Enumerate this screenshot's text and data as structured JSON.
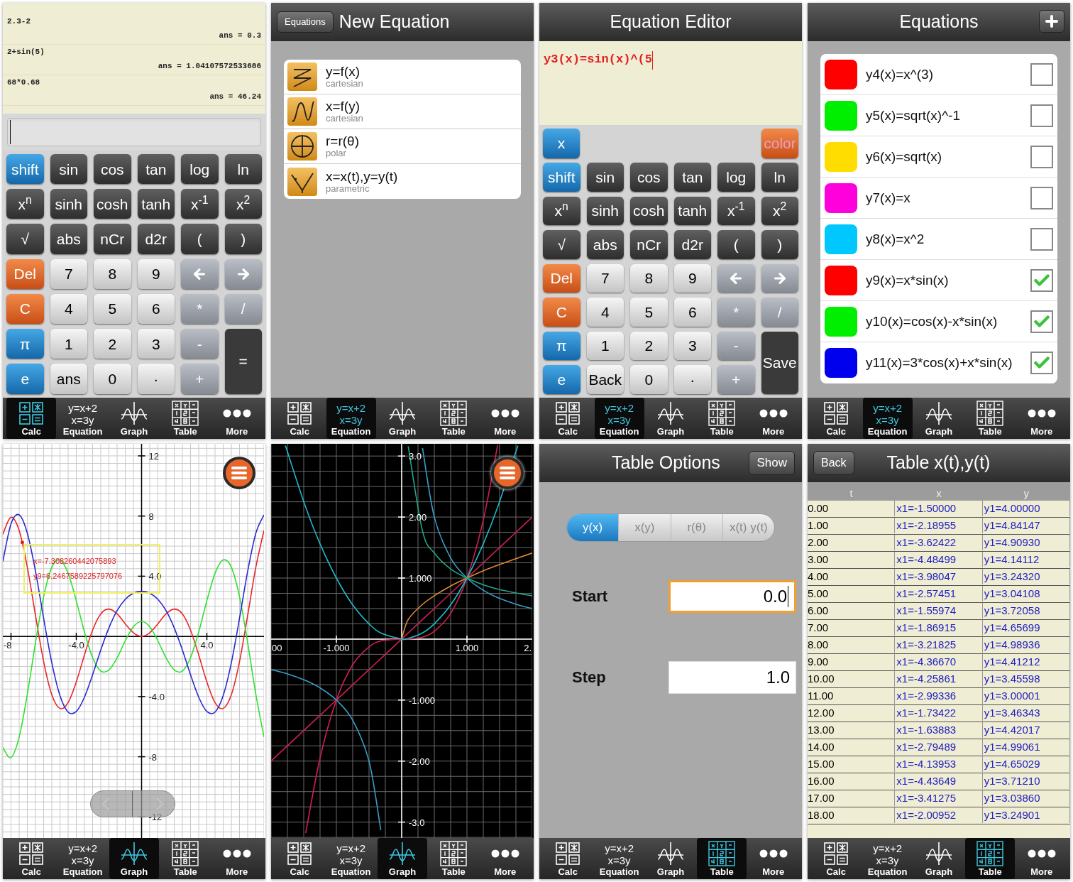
{
  "panels": [
    {
      "kind": "calculator",
      "history": [
        {
          "expr": "2.3-2",
          "result": "ans = 0.3"
        },
        {
          "expr": "2+sin(5)",
          "result": "ans = 1.04107572533686"
        },
        {
          "expr": "68*0.68",
          "result": "ans = 46.24"
        }
      ],
      "key_rows": [
        [
          {
            "label": "shift",
            "kind": "blue"
          },
          {
            "label": "sin",
            "kind": "fn"
          },
          {
            "label": "cos",
            "kind": "fn"
          },
          {
            "label": "tan",
            "kind": "fn"
          },
          {
            "label": "log",
            "kind": "fn"
          },
          {
            "label": "ln",
            "kind": "fn"
          }
        ],
        [
          {
            "label": "x$^{n}$",
            "kind": "fn"
          },
          {
            "label": "sinh",
            "kind": "fn"
          },
          {
            "label": "cosh",
            "kind": "fn"
          },
          {
            "label": "tanh",
            "kind": "fn"
          },
          {
            "label": "x$^{-1}$",
            "kind": "fn"
          },
          {
            "label": "x$^{2}$",
            "kind": "fn"
          }
        ],
        [
          {
            "label": "√",
            "kind": "fn"
          },
          {
            "label": "abs",
            "kind": "fn"
          },
          {
            "label": "nCr",
            "kind": "fn"
          },
          {
            "label": "d2r",
            "kind": "fn"
          },
          {
            "label": "(",
            "kind": "fn"
          },
          {
            "label": ")",
            "kind": "fn"
          }
        ],
        [
          {
            "label": "Del",
            "kind": "red"
          },
          {
            "label": "7",
            "kind": "num"
          },
          {
            "label": "8",
            "kind": "num"
          },
          {
            "label": "9",
            "kind": "num"
          },
          {
            "kind": "left"
          },
          {
            "kind": "right"
          }
        ],
        [
          {
            "label": "C",
            "kind": "red"
          },
          {
            "label": "4",
            "kind": "num"
          },
          {
            "label": "5",
            "kind": "num"
          },
          {
            "label": "6",
            "kind": "num"
          },
          {
            "label": "*",
            "kind": "op"
          },
          {
            "label": "/",
            "kind": "op"
          }
        ],
        [
          {
            "label": "π",
            "kind": "blue"
          },
          {
            "label": "1",
            "kind": "num"
          },
          {
            "label": "2",
            "kind": "num"
          },
          {
            "label": "3",
            "kind": "num"
          },
          {
            "label": "-",
            "kind": "op"
          },
          {
            "label": "=",
            "kind": "tall"
          }
        ],
        [
          {
            "label": "e",
            "kind": "blue"
          },
          {
            "label": "ans",
            "kind": "num"
          },
          {
            "label": "0",
            "kind": "num"
          },
          {
            "label": "·",
            "kind": "num"
          },
          {
            "label": "+",
            "kind": "op"
          }
        ]
      ],
      "nav": [
        {
          "kind": "calc",
          "label": "Calc",
          "selected": true
        },
        {
          "kind": "equation",
          "lines": [
            "y=x+2",
            "x=3y"
          ],
          "label": "Equation",
          "selected": false
        },
        {
          "kind": "graph",
          "label": "Graph",
          "selected": false
        },
        {
          "kind": "table",
          "label": "Table",
          "selected": false
        },
        {
          "kind": "more",
          "label": "More",
          "selected": false
        }
      ]
    },
    {
      "kind": "new_equation",
      "back": "Equations",
      "title": "New Equation",
      "types": [
        {
          "kind": "cartesian_y",
          "title": "y=f(x)",
          "subtitle": "cartesian"
        },
        {
          "kind": "cartesian_x",
          "title": "x=f(y)",
          "subtitle": "cartesian"
        },
        {
          "kind": "polar",
          "title": "r=r(θ)",
          "subtitle": "polar"
        },
        {
          "kind": "parametric",
          "title": "x=x(t),y=y(t)",
          "subtitle": "parametric"
        }
      ],
      "nav": [
        {
          "kind": "calc",
          "label": "Calc",
          "selected": false
        },
        {
          "kind": "equation",
          "lines": [
            "y=x+2",
            "x=3y"
          ],
          "label": "Equation",
          "selected": true
        },
        {
          "kind": "graph",
          "label": "Graph",
          "selected": false
        },
        {
          "kind": "table",
          "label": "Table",
          "selected": false
        },
        {
          "kind": "more",
          "label": "More",
          "selected": false
        }
      ]
    },
    {
      "kind": "equation_editor",
      "title": "Equation Editor",
      "expression": "y3(x)=sin(x)^(5",
      "top_keys": [
        {
          "label": "x",
          "kind": "blue"
        },
        {
          "label": "color",
          "kind": "color"
        }
      ],
      "key_rows": [
        [
          {
            "label": "shift",
            "kind": "blue"
          },
          {
            "label": "sin",
            "kind": "fn"
          },
          {
            "label": "cos",
            "kind": "fn"
          },
          {
            "label": "tan",
            "kind": "fn"
          },
          {
            "label": "log",
            "kind": "fn"
          },
          {
            "label": "ln",
            "kind": "fn"
          }
        ],
        [
          {
            "label": "x$^{n}$",
            "kind": "fn"
          },
          {
            "label": "sinh",
            "kind": "fn"
          },
          {
            "label": "cosh",
            "kind": "fn"
          },
          {
            "label": "tanh",
            "kind": "fn"
          },
          {
            "label": "x$^{-1}$",
            "kind": "fn"
          },
          {
            "label": "x$^{2}$",
            "kind": "fn"
          }
        ],
        [
          {
            "label": "√",
            "kind": "fn"
          },
          {
            "label": "abs",
            "kind": "fn"
          },
          {
            "label": "nCr",
            "kind": "fn"
          },
          {
            "label": "d2r",
            "kind": "fn"
          },
          {
            "label": "(",
            "kind": "fn"
          },
          {
            "label": ")",
            "kind": "fn"
          }
        ],
        [
          {
            "label": "Del",
            "kind": "red"
          },
          {
            "label": "7",
            "kind": "num"
          },
          {
            "label": "8",
            "kind": "num"
          },
          {
            "label": "9",
            "kind": "num"
          },
          {
            "kind": "left"
          },
          {
            "kind": "right"
          }
        ],
        [
          {
            "label": "C",
            "kind": "red"
          },
          {
            "label": "4",
            "kind": "num"
          },
          {
            "label": "5",
            "kind": "num"
          },
          {
            "label": "6",
            "kind": "num"
          },
          {
            "label": "*",
            "kind": "op"
          },
          {
            "label": "/",
            "kind": "op"
          }
        ],
        [
          {
            "label": "π",
            "kind": "blue"
          },
          {
            "label": "1",
            "kind": "num"
          },
          {
            "label": "2",
            "kind": "num"
          },
          {
            "label": "3",
            "kind": "num"
          },
          {
            "label": "-",
            "kind": "op"
          },
          {
            "label": "Save",
            "kind": "tall"
          }
        ],
        [
          {
            "label": "e",
            "kind": "blue"
          },
          {
            "label": "Back",
            "kind": "num"
          },
          {
            "label": "0",
            "kind": "num"
          },
          {
            "label": "·",
            "kind": "num"
          },
          {
            "label": "+",
            "kind": "op"
          }
        ]
      ],
      "nav": [
        {
          "kind": "calc",
          "label": "Calc",
          "selected": false
        },
        {
          "kind": "equation",
          "lines": [
            "y=x+2",
            "x=3y"
          ],
          "label": "Equation",
          "selected": true
        },
        {
          "kind": "graph",
          "label": "Graph",
          "selected": false
        },
        {
          "kind": "table",
          "label": "Table",
          "selected": false
        },
        {
          "kind": "more",
          "label": "More",
          "selected": false
        }
      ]
    },
    {
      "kind": "equation_list",
      "title": "Equations",
      "equations": [
        {
          "label": "y4(x)=x^(3)",
          "color": "#ff0000",
          "checked": false
        },
        {
          "label": "y5(x)=sqrt(x)^-1",
          "color": "#00ee00",
          "checked": false
        },
        {
          "label": "y6(x)=sqrt(x)",
          "color": "#ffdd00",
          "checked": false
        },
        {
          "label": "y7(x)=x",
          "color": "#ff00dd",
          "checked": false
        },
        {
          "label": "y8(x)=x^2",
          "color": "#00c8ff",
          "checked": false
        },
        {
          "label": "y9(x)=x*sin(x)",
          "color": "#ff0000",
          "checked": true
        },
        {
          "label": "y10(x)=cos(x)-x*sin(x)",
          "color": "#00ee00",
          "checked": true
        },
        {
          "label": "y11(x)=3*cos(x)+x*sin(x)",
          "color": "#0000ee",
          "checked": true
        }
      ],
      "nav": [
        {
          "kind": "calc",
          "label": "Calc",
          "selected": false
        },
        {
          "kind": "equation",
          "lines": [
            "y=x+2",
            "x=3y"
          ],
          "label": "Equation",
          "selected": true
        },
        {
          "kind": "graph",
          "label": "Graph",
          "selected": false
        },
        {
          "kind": "table",
          "label": "Table",
          "selected": false
        },
        {
          "kind": "more",
          "label": "More",
          "selected": false
        }
      ]
    },
    {
      "kind": "graph_light",
      "trace": [
        "x=-7.308260442075893",
        "y9=6.2467589225797076"
      ],
      "chart_data": {
        "type": "line",
        "x": [
          -8.5,
          -8,
          -7.5,
          -7,
          -6.5,
          -6,
          -5.5,
          -5,
          -4.5,
          -4,
          -3.5,
          -3,
          -2.5,
          -2,
          -1.5,
          -1,
          -0.5,
          0,
          0.5,
          1,
          1.5,
          2,
          2.5,
          3,
          3.5,
          4,
          4.5,
          5,
          5.5,
          6,
          6.5,
          7,
          7.5
        ],
        "series": [
          {
            "color": "#e8262a",
            "values": [
              6.79,
              7.92,
              7.04,
              4.6,
              1.4,
              -1.68,
              -3.88,
              -4.79,
              -4.4,
              -3.03,
              -1.23,
              0.42,
              1.5,
              1.82,
              1.5,
              0.84,
              0.24,
              0,
              0.24,
              0.84,
              1.5,
              1.82,
              1.5,
              0.42,
              -1.23,
              -3.03,
              -4.4,
              -4.79,
              -3.88,
              -1.68,
              1.4,
              4.6,
              7.04
            ]
          },
          {
            "color": "#30e030",
            "values": [
              -7.39,
              -8.06,
              -6.69,
              -3.85,
              -0.42,
              2.64,
              4.59,
              5.08,
              4.19,
              2.37,
              0.29,
              -1.41,
              -2.3,
              -2.23,
              -1.43,
              -0.3,
              0.64,
              1,
              0.64,
              -0.3,
              -1.43,
              -2.23,
              -2.3,
              -1.41,
              0.29,
              2.37,
              4.19,
              5.08,
              4.59,
              2.64,
              -0.42,
              -3.85,
              -6.69
            ]
          },
          {
            "color": "#2a2ad0",
            "values": [
              4.98,
              7.48,
              8.08,
              6.86,
              4.33,
              1.2,
              -1.75,
              -3.94,
              -5.03,
              -4.99,
              -4.04,
              -2.55,
              -0.9,
              0.57,
              1.71,
              2.46,
              2.87,
              3,
              2.87,
              2.46,
              1.71,
              0.57,
              -0.9,
              -2.55,
              -4.04,
              -4.99,
              -5.03,
              -3.94,
              -1.75,
              1.2,
              4.33,
              6.86,
              8.08
            ]
          }
        ],
        "grid": true,
        "xlim": [
          -8.5,
          7.5
        ],
        "ylim": [
          -13.4,
          12.8
        ],
        "xticks": [
          {
            "value": -8,
            "label": "-8"
          },
          {
            "value": -4,
            "label": "-4.0"
          },
          {
            "value": 4,
            "label": "4.0"
          }
        ],
        "yticks": [
          {
            "value": 12,
            "label": "12"
          },
          {
            "value": 8,
            "label": "8"
          },
          {
            "value": 4,
            "label": "4.0"
          },
          {
            "value": -4,
            "label": "-4.0"
          },
          {
            "value": -8,
            "label": "-8"
          },
          {
            "value": -12,
            "label": "-12"
          }
        ]
      },
      "nav": [
        {
          "kind": "calc",
          "label": "Calc",
          "selected": false
        },
        {
          "kind": "equation",
          "lines": [
            "y=x+2",
            "x=3y"
          ],
          "label": "Equation",
          "selected": false
        },
        {
          "kind": "graph",
          "label": "Graph",
          "selected": true
        },
        {
          "kind": "table",
          "label": "Table",
          "selected": false
        },
        {
          "kind": "more",
          "label": "More",
          "selected": false
        }
      ]
    },
    {
      "kind": "graph_dark",
      "edge_labels": [
        "00",
        "2."
      ],
      "chart_data": {
        "type": "line",
        "x": [
          -2,
          -1.78,
          -1.47,
          -1.25,
          -1,
          -0.75,
          -0.5,
          -0.32,
          0,
          0.1,
          0.32,
          0.5,
          0.75,
          1,
          1.25,
          1.47,
          1.78,
          2
        ],
        "series": [
          {
            "color": "#d02050",
            "values": [
              null,
              null,
              -3.18,
              -1.95,
              -1,
              -0.42,
              -0.13,
              -0.03,
              0,
              0,
              0.03,
              0.13,
              0.42,
              1,
              1.95,
              3.18,
              null,
              null
            ]
          },
          {
            "color": "#d02050",
            "values": [
              -2,
              -1.78,
              -1.47,
              -1.25,
              -1,
              -0.75,
              -0.5,
              -0.32,
              0,
              0.1,
              0.32,
              0.5,
              0.75,
              1,
              1.25,
              1.47,
              1.78,
              2
            ]
          },
          {
            "color": "#20b8c8",
            "values": [
              null,
              3.17,
              2.16,
              1.56,
              1,
              0.56,
              0.25,
              0.1,
              0,
              0.01,
              0.1,
              0.25,
              0.56,
              1,
              1.56,
              2.16,
              3.17,
              null
            ]
          },
          {
            "color": "#e08a30",
            "values": [
              null,
              null,
              null,
              null,
              null,
              null,
              null,
              null,
              0,
              0.32,
              0.57,
              0.71,
              0.87,
              1,
              1.12,
              1.21,
              1.33,
              1.41
            ]
          },
          {
            "color": "#3a9ec8",
            "values": [
              -0.5,
              -0.56,
              -0.68,
              -0.8,
              -1,
              -1.33,
              -2,
              -3.13,
              null,
              null,
              3.13,
              2,
              1.33,
              1,
              0.8,
              0.68,
              0.56,
              0.5
            ]
          },
          {
            "color": "#1fa88a",
            "values": [
              null,
              null,
              null,
              null,
              null,
              null,
              null,
              null,
              null,
              3.16,
              1.77,
              1.41,
              1.15,
              1,
              0.89,
              0.82,
              0.75,
              0.71
            ]
          }
        ],
        "grid": true,
        "xlim": [
          -2,
          2
        ],
        "ylim": [
          -3.26,
          3.2
        ],
        "xticks": [
          {
            "value": -1,
            "label": "-1.000"
          },
          {
            "value": 1,
            "label": "1.000"
          }
        ],
        "yticks": [
          {
            "value": 3,
            "label": "3.0"
          },
          {
            "value": 2,
            "label": "2.00"
          },
          {
            "value": 1,
            "label": "1.000"
          },
          {
            "value": -1,
            "label": "-1.000"
          },
          {
            "value": -2,
            "label": "-2.00"
          },
          {
            "value": -3,
            "label": "-3.0"
          }
        ]
      },
      "nav": [
        {
          "kind": "calc",
          "label": "Calc",
          "selected": false
        },
        {
          "kind": "equation",
          "lines": [
            "y=x+2",
            "x=3y"
          ],
          "label": "Equation",
          "selected": false
        },
        {
          "kind": "graph",
          "label": "Graph",
          "selected": true
        },
        {
          "kind": "table",
          "label": "Table",
          "selected": false
        },
        {
          "kind": "more",
          "label": "More",
          "selected": false
        }
      ]
    },
    {
      "kind": "table_options",
      "title": "Table Options",
      "action": "Show",
      "modes": [
        {
          "label": "y(x)",
          "selected": true
        },
        {
          "label": "x(y)",
          "selected": false
        },
        {
          "label": "r(θ)",
          "selected": false
        },
        {
          "label": "x(t) y(t)",
          "selected": false
        }
      ],
      "fields": [
        {
          "label": "Start",
          "value": "0.0",
          "focused": true
        },
        {
          "label": "Step",
          "value": "1.0",
          "focused": false
        }
      ],
      "nav": [
        {
          "kind": "calc",
          "label": "Calc",
          "selected": false
        },
        {
          "kind": "equation",
          "lines": [
            "y=x+2",
            "x=3y"
          ],
          "label": "Equation",
          "selected": false
        },
        {
          "kind": "graph",
          "label": "Graph",
          "selected": false
        },
        {
          "kind": "table",
          "label": "Table",
          "selected": true
        },
        {
          "kind": "more",
          "label": "More",
          "selected": false
        }
      ]
    },
    {
      "kind": "table",
      "back": "Back",
      "title": "Table x(t),y(t)",
      "columns": [
        "t",
        "x",
        "y"
      ],
      "rows": [
        [
          "0.00",
          "x1=-1.50000",
          "y1=4.00000"
        ],
        [
          "1.00",
          "x1=-2.18955",
          "y1=4.84147"
        ],
        [
          "2.00",
          "x1=-3.62422",
          "y1=4.90930"
        ],
        [
          "3.00",
          "x1=-4.48499",
          "y1=4.14112"
        ],
        [
          "4.00",
          "x1=-3.98047",
          "y1=3.24320"
        ],
        [
          "5.00",
          "x1=-2.57451",
          "y1=3.04108"
        ],
        [
          "6.00",
          "x1=-1.55974",
          "y1=3.72058"
        ],
        [
          "7.00",
          "x1=-1.86915",
          "y1=4.65699"
        ],
        [
          "8.00",
          "x1=-3.21825",
          "y1=4.98936"
        ],
        [
          "9.00",
          "x1=-4.36670",
          "y1=4.41212"
        ],
        [
          "10.00",
          "x1=-4.25861",
          "y1=3.45598"
        ],
        [
          "11.00",
          "x1=-2.99336",
          "y1=3.00001"
        ],
        [
          "12.00",
          "x1=-1.73422",
          "y1=3.46343"
        ],
        [
          "13.00",
          "x1=-1.63883",
          "y1=4.42017"
        ],
        [
          "14.00",
          "x1=-2.79489",
          "y1=4.99061"
        ],
        [
          "15.00",
          "x1=-4.13953",
          "y1=4.65029"
        ],
        [
          "16.00",
          "x1=-4.43649",
          "y1=3.71210"
        ],
        [
          "17.00",
          "x1=-3.41275",
          "y1=3.03860"
        ],
        [
          "18.00",
          "x1=-2.00952",
          "y1=3.24901"
        ]
      ],
      "nav": [
        {
          "kind": "calc",
          "label": "Calc",
          "selected": false
        },
        {
          "kind": "equation",
          "lines": [
            "y=x+2",
            "x=3y"
          ],
          "label": "Equation",
          "selected": false
        },
        {
          "kind": "graph",
          "label": "Graph",
          "selected": false
        },
        {
          "kind": "table",
          "label": "Table",
          "selected": true
        },
        {
          "kind": "more",
          "label": "More",
          "selected": false
        }
      ]
    }
  ]
}
